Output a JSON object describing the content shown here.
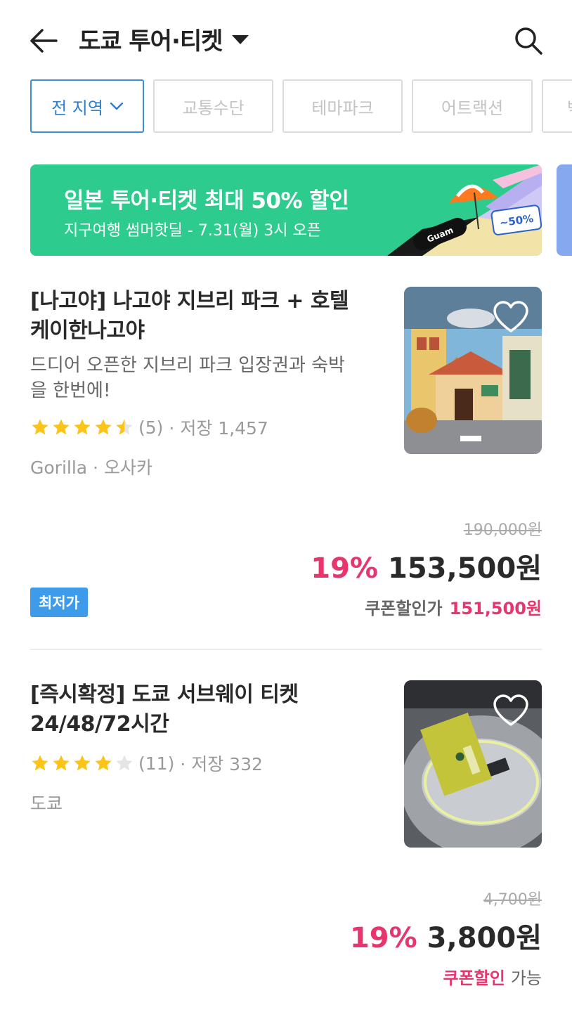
{
  "header": {
    "title": "도쿄 투어·티켓"
  },
  "filters": [
    {
      "label": "전 지역",
      "active": true
    },
    {
      "label": "교통수단",
      "active": false
    },
    {
      "label": "테마파크",
      "active": false
    },
    {
      "label": "어트랙션",
      "active": false
    },
    {
      "label": "박",
      "active": false
    }
  ],
  "banner": {
    "title": "일본 투어·티켓 최대 50% 할인",
    "subtitle": "지구여행 썸머핫딜 - 7.31(월) 3시 오픈",
    "art_sign_text": "Guam",
    "art_tag_text": "~50%",
    "bg_color": "#2ecb8e"
  },
  "products": [
    {
      "title_line1": "[나고야] 나고야 지브리 파크 + 호텔",
      "title_line2": "케이한나고야",
      "desc_line1": "드디어 오픈한 지브리 파크 입장권과 숙박",
      "desc_line2": "을 한번에!",
      "rating": 4.5,
      "review_count": "(5)",
      "saves": "· 저장 1,457",
      "meta": "Gorilla · 오사카",
      "original_price": "190,000원",
      "discount": "19%",
      "price": "153,500원",
      "coupon_label": "쿠폰할인가",
      "coupon_price": "151,500원",
      "badge": "최저가"
    },
    {
      "title_line1": "[즉시확정] 도쿄 서브웨이 티켓",
      "title_line2": "24/48/72시간",
      "rating": 4,
      "review_count": "(11)",
      "saves": "· 저장 332",
      "meta": "도쿄",
      "original_price": "4,700원",
      "discount": "19%",
      "price": "3,800원",
      "coupon_label": "쿠폰할인",
      "coupon_suffix": "가능"
    }
  ],
  "colors": {
    "accent": "#2f7fd0",
    "discount": "#e8356d",
    "star": "#fcc419",
    "badge": "#3d9be9"
  }
}
